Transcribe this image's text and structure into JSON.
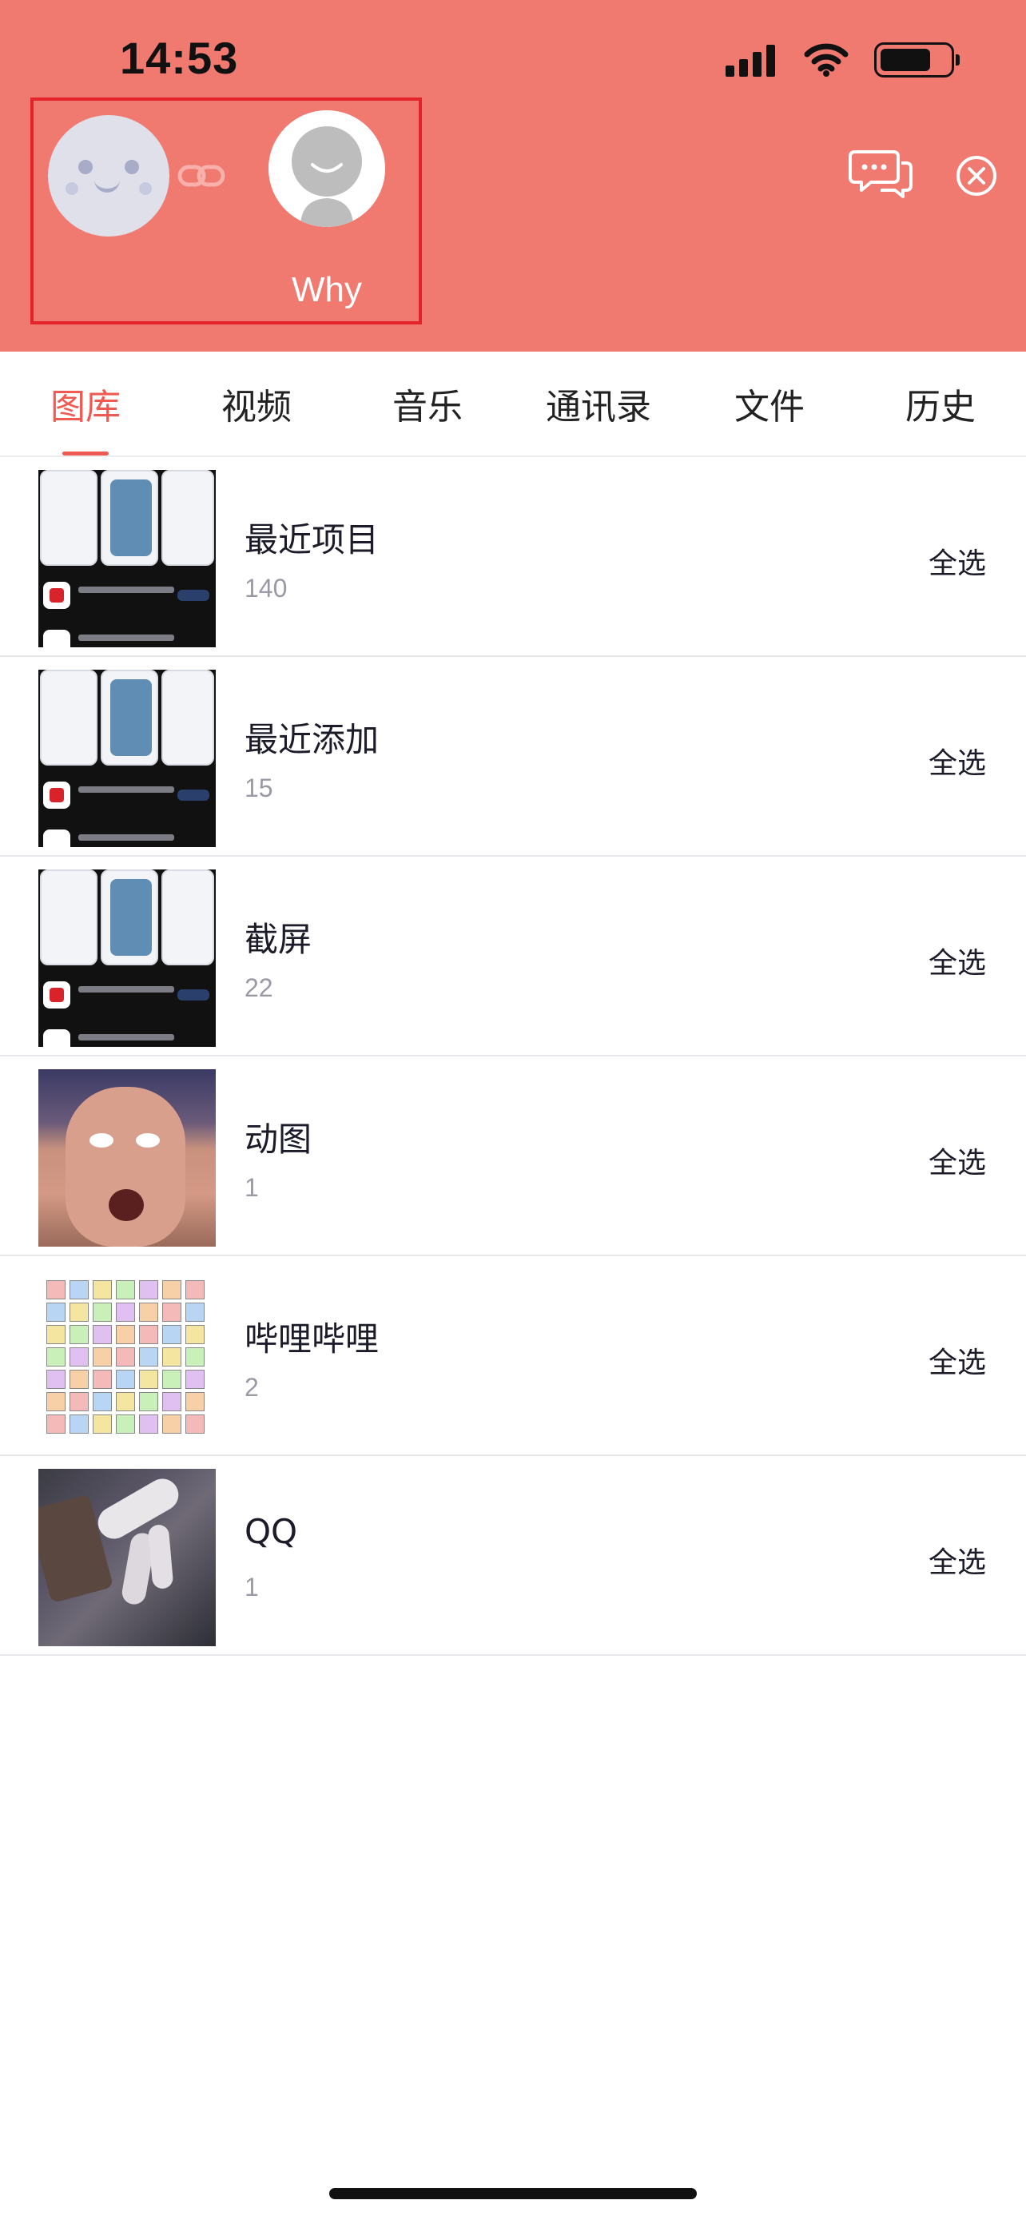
{
  "status_bar": {
    "time": "14:53"
  },
  "header": {
    "background_color": "#f07970",
    "peer_name": "Why",
    "icons": [
      "link-icon",
      "chat-bubbles-icon",
      "close-circle-icon"
    ]
  },
  "tabs": [
    {
      "label": "图库",
      "active": true
    },
    {
      "label": "视频",
      "active": false
    },
    {
      "label": "音乐",
      "active": false
    },
    {
      "label": "通讯录",
      "active": false
    },
    {
      "label": "文件",
      "active": false
    },
    {
      "label": "历史",
      "active": false
    }
  ],
  "albums": [
    {
      "name": "最近项目",
      "count": "140",
      "action": "全选"
    },
    {
      "name": "最近添加",
      "count": "15",
      "action": "全选"
    },
    {
      "name": "截屏",
      "count": "22",
      "action": "全选"
    },
    {
      "name": "动图",
      "count": "1",
      "action": "全选"
    },
    {
      "name": "哔哩哔哩",
      "count": "2",
      "action": "全选"
    },
    {
      "name": "QQ",
      "count": "1",
      "action": "全选"
    }
  ],
  "accent_color": "#ef5b52"
}
